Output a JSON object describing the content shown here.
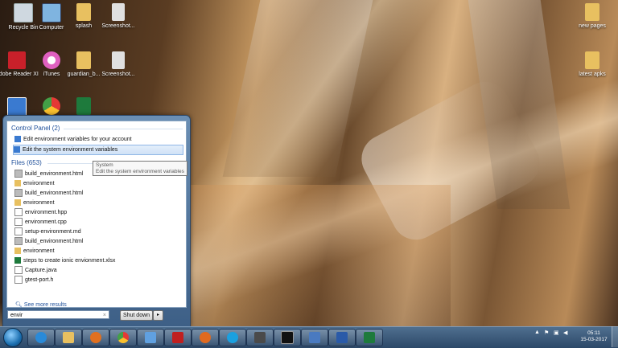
{
  "desktop_icons": [
    {
      "name": "recycle-bin-icon",
      "label": "Recycle Bin",
      "color": "#cfd8e0"
    },
    {
      "name": "computer-icon",
      "label": "Computer",
      "color": "#7fb4e0"
    },
    {
      "name": "folder-icon",
      "label": "splash",
      "color": "#e8c060"
    },
    {
      "name": "screenshot-file-icon",
      "label": "Screenshot...",
      "color": "#e0e0e0"
    },
    {
      "name": "adobe-reader-icon",
      "label": "Adobe Reader XI",
      "color": "#c8202a"
    },
    {
      "name": "itunes-icon",
      "label": "iTunes",
      "color": "#e060c0"
    },
    {
      "name": "folder-icon",
      "label": "guardian_b...",
      "color": "#e8c060"
    },
    {
      "name": "screenshot-file-icon",
      "label": "Screenshot...",
      "color": "#e0e0e0"
    },
    {
      "name": "control-panel-icon",
      "label": "",
      "color": "#3a7ad0"
    },
    {
      "name": "chrome-icon",
      "label": "",
      "color": "#4caf50"
    },
    {
      "name": "excel-icon",
      "label": "",
      "color": "#1e7a3c"
    },
    {
      "name": "folder-icon",
      "label": "new pages",
      "color": "#e8c060"
    },
    {
      "name": "folder-icon",
      "label": "latest apks",
      "color": "#e8c060"
    }
  ],
  "start_menu": {
    "control_panel_header": "Control Panel (2)",
    "control_panel_items": [
      {
        "label": "Edit environment variables for your account",
        "selected": false
      },
      {
        "label": "Edit the system environment variables",
        "selected": true
      }
    ],
    "files_header": "Files (653)",
    "files": [
      {
        "label": "build_environment.html",
        "icon": "html-file-icon"
      },
      {
        "label": "environment",
        "icon": "folder-icon"
      },
      {
        "label": "build_environment.html",
        "icon": "html-file-icon"
      },
      {
        "label": "environment",
        "icon": "folder-icon"
      },
      {
        "label": "environment.hpp",
        "icon": "file-icon"
      },
      {
        "label": "environment.cpp",
        "icon": "file-icon"
      },
      {
        "label": "setup-environment.md",
        "icon": "file-icon"
      },
      {
        "label": "build_environment.html",
        "icon": "html-file-icon"
      },
      {
        "label": "environment",
        "icon": "folder-icon"
      },
      {
        "label": "steps to create ionic envionment.xlsx",
        "icon": "excel-file-icon"
      },
      {
        "label": "Capture.java",
        "icon": "file-icon"
      },
      {
        "label": "gtest-port.h",
        "icon": "file-icon"
      }
    ],
    "see_more": "See more results",
    "tooltip_title": "System",
    "tooltip_text": "Edit the system environment variables",
    "search_value": "envir",
    "shutdown_label": "Shut down"
  },
  "taskbar": {
    "apps": [
      {
        "name": "ie-icon",
        "color": "#2a8ad8"
      },
      {
        "name": "explorer-icon",
        "color": "#e8c060"
      },
      {
        "name": "media-player-icon",
        "color": "#e07020"
      },
      {
        "name": "chrome-icon",
        "color": "#4caf50"
      },
      {
        "name": "paint-icon",
        "color": "#60a0e0"
      },
      {
        "name": "filezilla-icon",
        "color": "#c02020"
      },
      {
        "name": "firefox-icon",
        "color": "#e06a20"
      },
      {
        "name": "skype-icon",
        "color": "#1aa0e0"
      },
      {
        "name": "sublime-icon",
        "color": "#4a4a4a"
      },
      {
        "name": "cmd-icon",
        "color": "#111111"
      },
      {
        "name": "remote-desktop-icon",
        "color": "#4a7ac0"
      },
      {
        "name": "word-icon",
        "color": "#2a5aa8"
      },
      {
        "name": "excel-icon",
        "color": "#1e7a3c"
      }
    ],
    "time": "05:11",
    "date": "15-03-2017"
  }
}
